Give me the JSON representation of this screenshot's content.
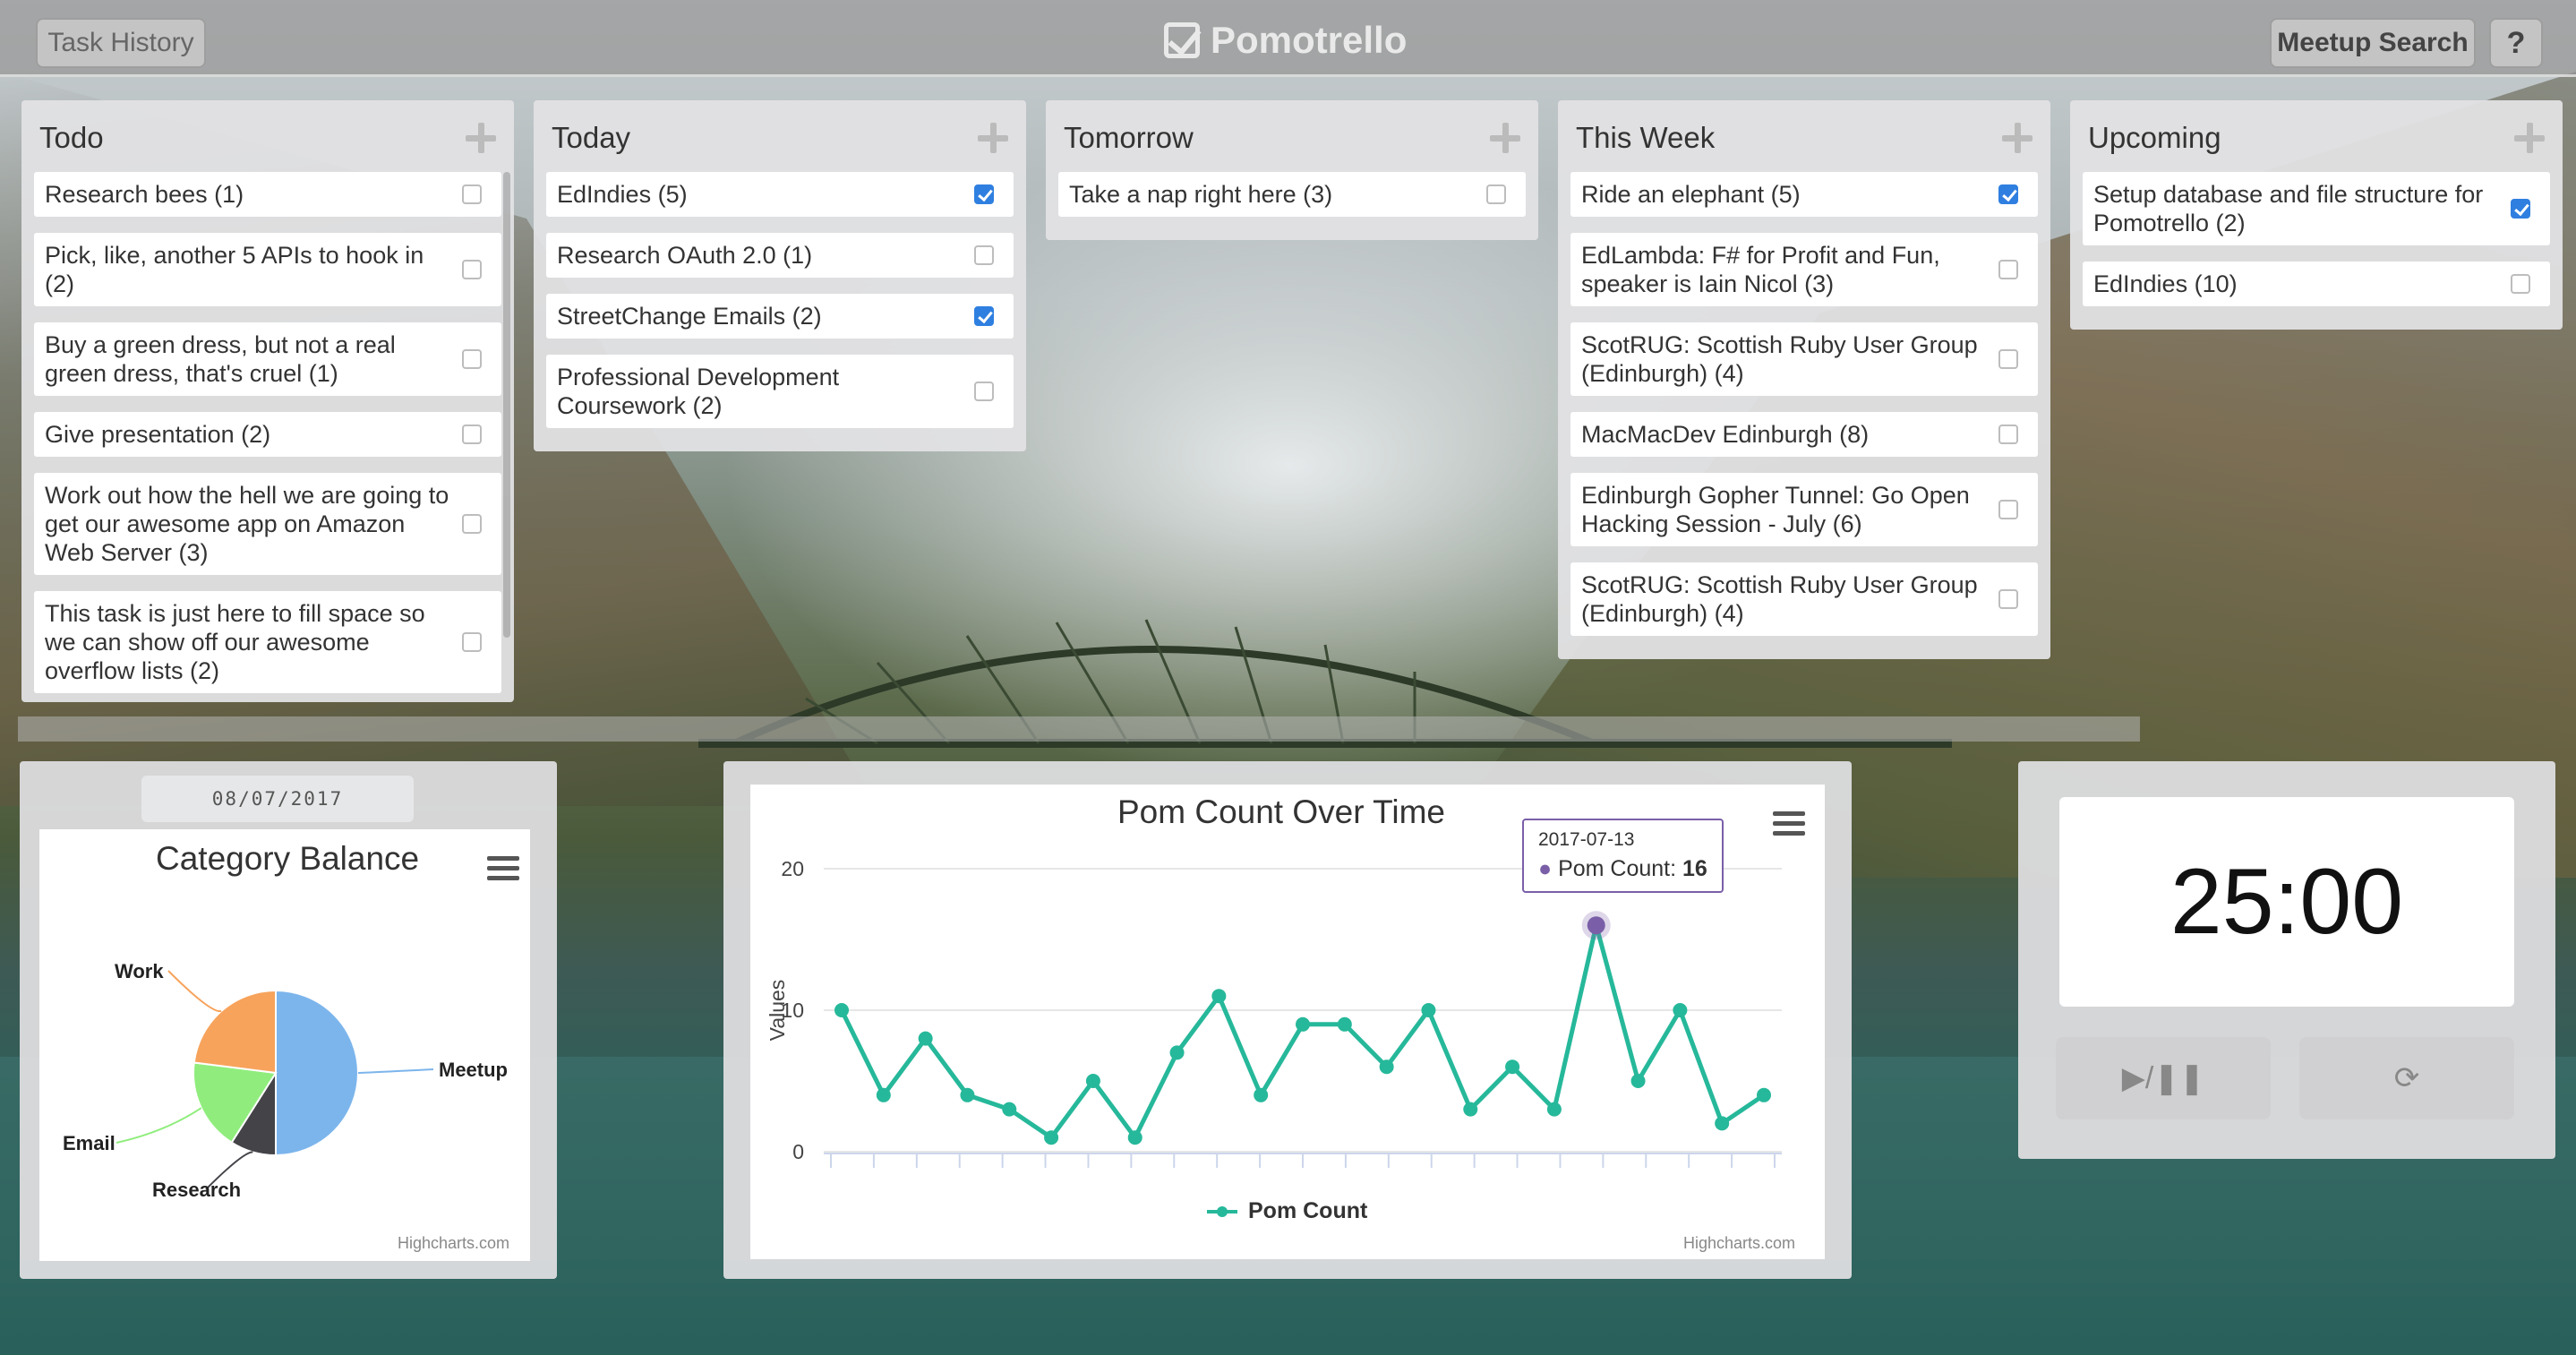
{
  "topbar": {
    "history_label": "Task History",
    "brand": "Pomotrello",
    "meetup_label": "Meetup Search",
    "help_label": "?"
  },
  "lists": [
    {
      "title": "Todo",
      "cards": [
        {
          "text": "Research bees (1)",
          "checked": false
        },
        {
          "text": "Pick, like, another 5 APIs to hook in (2)",
          "checked": false
        },
        {
          "text": "Buy a green dress, but not a real green dress, that's cruel (1)",
          "checked": false
        },
        {
          "text": "Give presentation (2)",
          "checked": false
        },
        {
          "text": "Work out how the hell we are going to get our awesome app on Amazon Web Server (3)",
          "checked": false
        },
        {
          "text": "This task is just here to fill space so we can show off our awesome overflow lists (2)",
          "checked": false
        }
      ]
    },
    {
      "title": "Today",
      "cards": [
        {
          "text": "EdIndies (5)",
          "checked": true
        },
        {
          "text": "Research OAuth 2.0 (1)",
          "checked": false
        },
        {
          "text": "StreetChange Emails (2)",
          "checked": true
        },
        {
          "text": "Professional Development Coursework (2)",
          "checked": false
        }
      ]
    },
    {
      "title": "Tomorrow",
      "cards": [
        {
          "text": "Take a nap right here (3)",
          "checked": false
        }
      ]
    },
    {
      "title": "This Week",
      "cards": [
        {
          "text": "Ride an elephant (5)",
          "checked": true
        },
        {
          "text": "EdLambda: F# for Profit and Fun, speaker is Iain Nicol (3)",
          "checked": false
        },
        {
          "text": "ScotRUG: Scottish Ruby User Group (Edinburgh) (4)",
          "checked": false
        },
        {
          "text": "MacMacDev Edinburgh (8)",
          "checked": false
        },
        {
          "text": "Edinburgh Gopher Tunnel: Go Open Hacking Session - July (6)",
          "checked": false
        },
        {
          "text": "ScotRUG: Scottish Ruby User Group (Edinburgh) (4)",
          "checked": false
        }
      ]
    },
    {
      "title": "Upcoming",
      "cards": [
        {
          "text": "Setup database and file structure for Pomotrello (2)",
          "checked": true
        },
        {
          "text": "EdIndies (10)",
          "checked": false
        }
      ]
    }
  ],
  "category": {
    "date": "08/07/2017",
    "credit": "Highcharts.com"
  },
  "pom": {
    "credit": "Highcharts.com",
    "tooltip_date": "2017-07-13",
    "tooltip_label": "Pom Count: ",
    "tooltip_value": "16"
  },
  "timer": {
    "display": "25:00",
    "play_pause_label": "▶/❚❚",
    "reset_label": "⟳"
  },
  "colors": {
    "accent_check": "#2f7fe0",
    "line": "#26b89a",
    "point": "#7a5fa8"
  },
  "icons": [
    "check-square-icon",
    "plus-icon",
    "checkbox-icon",
    "menu-icon",
    "play-pause-icon",
    "refresh-icon"
  ],
  "chart_data": [
    {
      "type": "pie",
      "title": "Category Balance",
      "categories": [
        "Meetup",
        "Research",
        "Email",
        "Work"
      ],
      "values": [
        50,
        9,
        18,
        23
      ],
      "colors": [
        "#7cb5ec",
        "#434348",
        "#90ed7d",
        "#f7a35c"
      ]
    },
    {
      "type": "line",
      "title": "Pom Count Over Time",
      "ylabel": "Values",
      "ylim": [
        0,
        20
      ],
      "yticks": [
        0,
        10,
        20
      ],
      "series": [
        {
          "name": "Pom Count",
          "values": [
            10,
            4,
            8,
            4,
            3,
            1,
            5,
            1,
            7,
            11,
            4,
            9,
            9,
            6,
            10,
            3,
            6,
            3,
            16,
            5,
            10,
            2,
            4
          ]
        }
      ]
    }
  ]
}
